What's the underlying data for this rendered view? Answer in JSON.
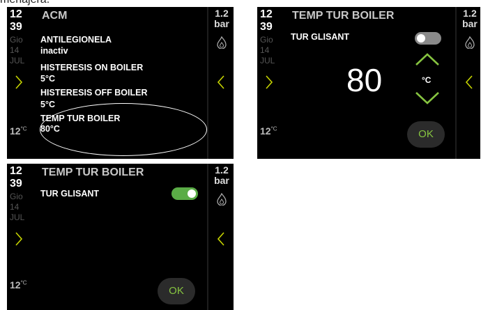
{
  "caption": "menajera.",
  "colors": {
    "accent_green": "#86c440",
    "toggle_off": "#8a8a8a",
    "toggle_on": "#5aac46"
  },
  "screen1": {
    "time_hour": "12",
    "time_min": "39",
    "dow": "Gio",
    "day": "14",
    "month": "JUL",
    "outside_temp": "12",
    "outside_unit": "°C",
    "pressure_value": "1.2",
    "pressure_unit": "bar",
    "title": "ACM",
    "items": [
      {
        "label": "ANTILEGIONELA",
        "value": "inactiv"
      },
      {
        "label": "HISTERESIS ON BOILER",
        "value": "5°C"
      },
      {
        "label": "HISTERESIS OFF BOILER",
        "value": "5°C"
      },
      {
        "label": "TEMP TUR BOILER",
        "value": "80°C"
      }
    ]
  },
  "screen2": {
    "time_hour": "12",
    "time_min": "39",
    "dow": "Gio",
    "day": "14",
    "month": "JUL",
    "outside_temp": "12",
    "outside_unit": "°C",
    "pressure_value": "1.2",
    "pressure_unit": "bar",
    "title": "TEMP TUR BOILER",
    "toggle_label": "TUR GLISANT",
    "toggle_state": "off",
    "setpoint": "80",
    "unit": "°C",
    "ok_label": "OK"
  },
  "screen3": {
    "time_hour": "12",
    "time_min": "39",
    "dow": "Gio",
    "day": "14",
    "month": "JUL",
    "outside_temp": "12",
    "outside_unit": "°C",
    "pressure_value": "1.2",
    "pressure_unit": "bar",
    "title": "TEMP TUR BOILER",
    "toggle_label": "TUR GLISANT",
    "toggle_state": "on",
    "ok_label": "OK"
  }
}
